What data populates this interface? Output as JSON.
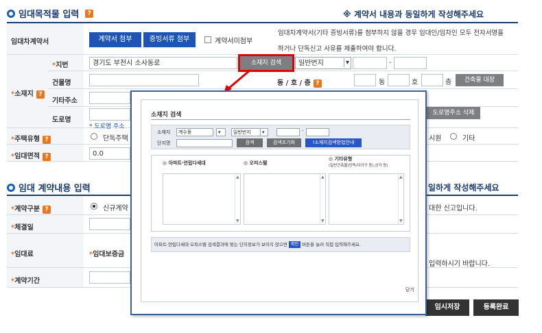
{
  "section1": {
    "title": "임대목적물 입력",
    "notice": "※ 계약서 내용과 동일하게 작성해주세요"
  },
  "contract_doc": {
    "label": "임대차계약서",
    "attach_contract": "계약서 첨부",
    "attach_proof": "증빙서류 첨부",
    "no_attach_label": "계약서미첨부",
    "note_line1": "임대차계약서(기타 증빙서류)를 첨부하지 않을 경우 임대인/임차인 모두 전자서명을",
    "note_line2": "하거나 단독신고 사유를 제출하여야 합니다."
  },
  "location": {
    "label": "소재지",
    "jibun_label": "지번",
    "jibun_value": "경기도 부천시 소사동로",
    "search_button": "소재지 검색",
    "lot_type": "일반번지",
    "building_label": "건물명",
    "dong_ho_label": "동 / 호 / 층",
    "dong_suffix": "동",
    "ho_suffix": "호",
    "floor_suffix": "층",
    "ledger_button": "건축물 대장",
    "extra_label": "기타주소",
    "road_label": "도로명",
    "road_note": "* 도로명 주소",
    "road_delete_button": "도로명주소 삭제"
  },
  "housing_type": {
    "label": "주택유형",
    "option1": "단독주택",
    "option_partial": "시원",
    "option_etc": "기타"
  },
  "area": {
    "label": "임대면적",
    "value": "0.0"
  },
  "section2": {
    "title": "임대 계약내용 입력",
    "notice_partial": "일하게 작성해주세요"
  },
  "contract_kind": {
    "label": "계약구분",
    "option1": "신규계약",
    "note_partial": "대한 신고입니다."
  },
  "conclude_date": {
    "label": "체결일"
  },
  "rent": {
    "label": "임대료",
    "deposit_label": "임대보증금",
    "note_partial": "입력하시기 바랍니다."
  },
  "period": {
    "label": "계약기간"
  },
  "buttons": {
    "temp_save": "임시저장",
    "register": "등록완료"
  },
  "popup": {
    "title": "소재지 검색",
    "region_label": "소재지",
    "region_value": "계수동",
    "lot_type": "일반번지",
    "complex_label": "단지명",
    "search_button": "검색",
    "reset_button": "검색조기화",
    "guide_button": "!소재지검색방법안내",
    "col1": "아파트·연립다세대",
    "col2": "오피스텔",
    "col3": "기타유형",
    "col3_sub": "(일반건축물(단독/다가구 등),상가 등)",
    "info_pre": "아파트·연립다세대·오피스텔 검색결과에 맞는 단지정보가 보이지 않으면",
    "info_btn": "확인",
    "info_post": "버튼을 눌러 직접 입력해주세요.",
    "close": "닫기"
  }
}
